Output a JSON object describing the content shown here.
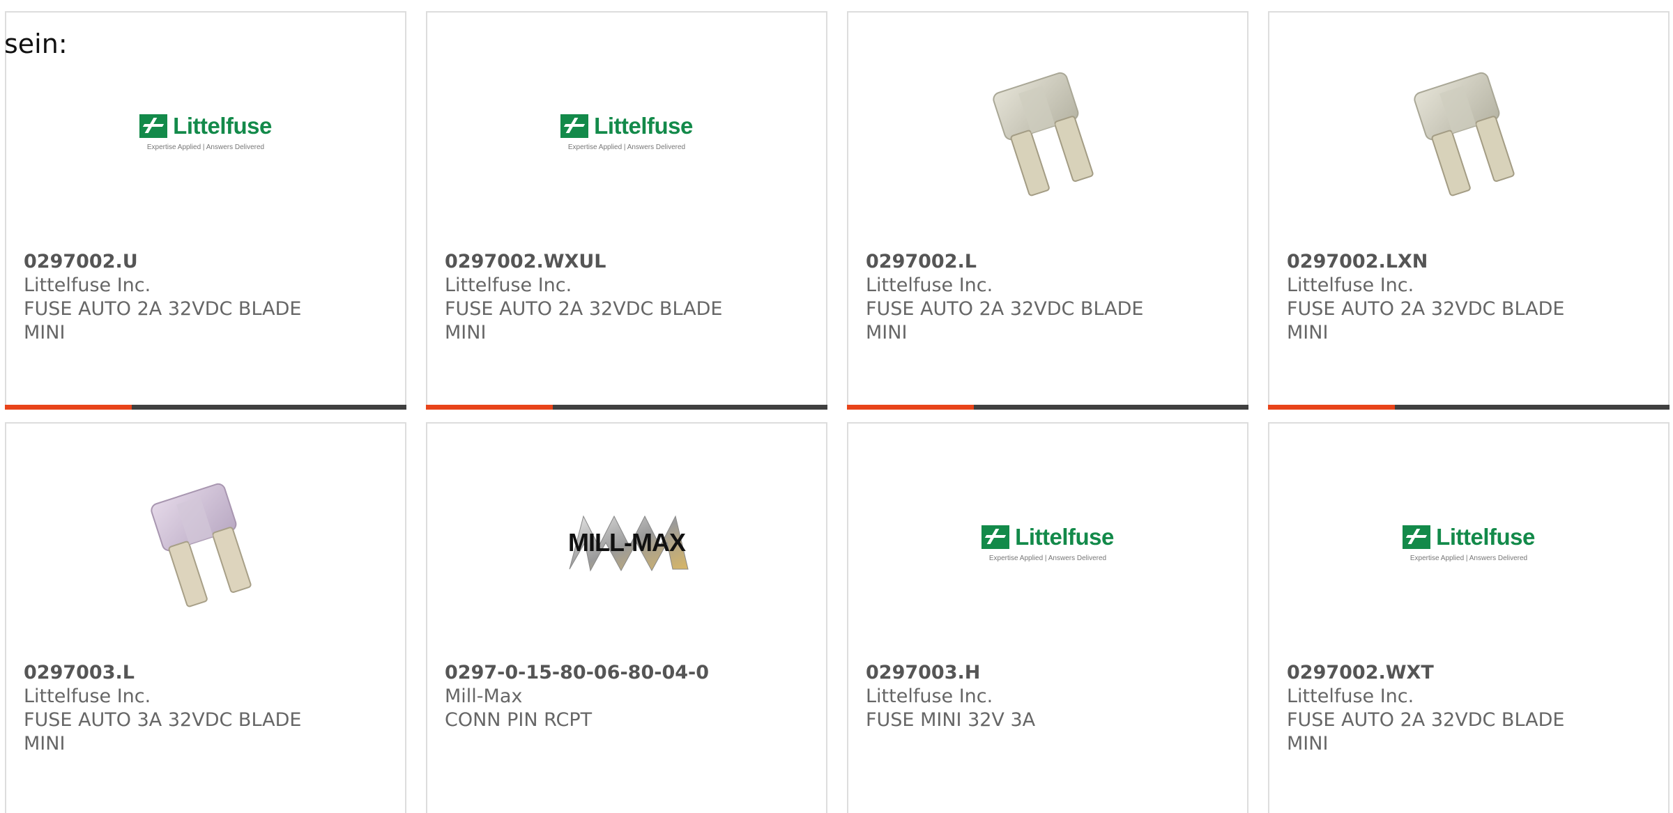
{
  "intro_text": "sein:",
  "theme": {
    "accent": "#e8441a",
    "bar_dark": "#404040",
    "littelfuse_green": "#138a4a"
  },
  "products": [
    {
      "part_number": "0297002.U",
      "manufacturer": "Littelfuse Inc.",
      "description": "FUSE AUTO 2A 32VDC BLADE MINI",
      "image": "littelfuse-logo"
    },
    {
      "part_number": "0297002.WXUL",
      "manufacturer": "Littelfuse Inc.",
      "description": "FUSE AUTO 2A 32VDC BLADE MINI",
      "image": "littelfuse-logo"
    },
    {
      "part_number": "0297002.L",
      "manufacturer": "Littelfuse Inc.",
      "description": "FUSE AUTO 2A 32VDC BLADE MINI",
      "image": "fuse-photo-clear"
    },
    {
      "part_number": "0297002.LXN",
      "manufacturer": "Littelfuse Inc.",
      "description": "FUSE AUTO 2A 32VDC BLADE MINI",
      "image": "fuse-photo-clear"
    },
    {
      "part_number": "0297003.L",
      "manufacturer": "Littelfuse Inc.",
      "description": "FUSE AUTO 3A 32VDC BLADE MINI",
      "image": "fuse-photo-violet"
    },
    {
      "part_number": "0297-0-15-80-06-80-04-0",
      "manufacturer": "Mill-Max",
      "description": "CONN PIN RCPT",
      "image": "mill-max-logo"
    },
    {
      "part_number": "0297003.H",
      "manufacturer": "Littelfuse Inc.",
      "description": "FUSE MINI 32V 3A",
      "image": "littelfuse-logo"
    },
    {
      "part_number": "0297002.WXT",
      "manufacturer": "Littelfuse Inc.",
      "description": "FUSE AUTO 2A 32VDC BLADE MINI",
      "image": "littelfuse-logo"
    }
  ],
  "logos": {
    "littelfuse_word": "Littelfuse",
    "littelfuse_tagline": "Expertise Applied | Answers Delivered",
    "millmax_word": "MILL-MAX"
  }
}
